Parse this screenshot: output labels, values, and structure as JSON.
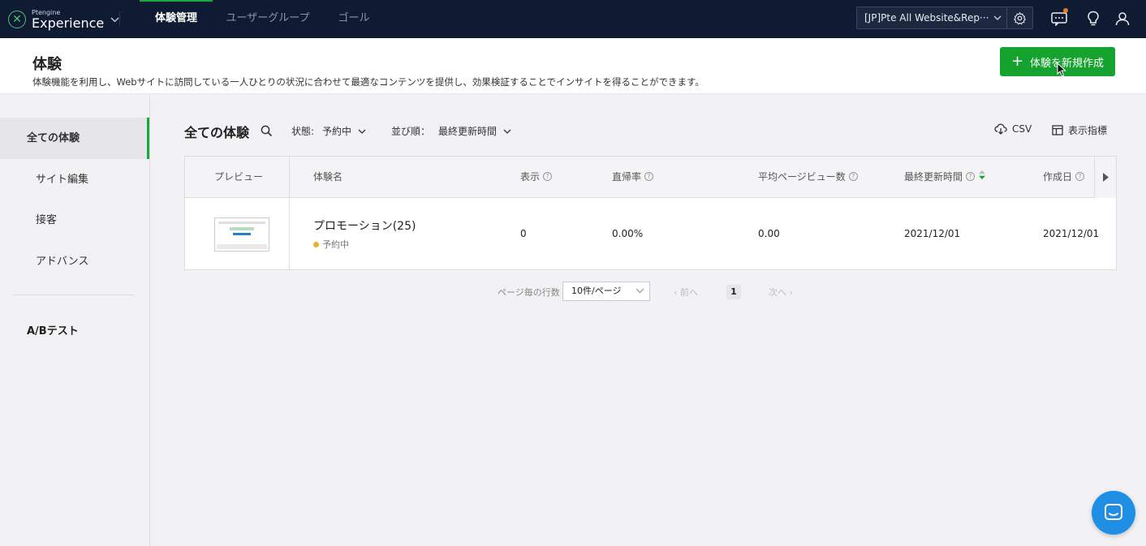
{
  "app": {
    "logo_small": "Ptengine",
    "logo_big": "Experience"
  },
  "nav": {
    "tabs": [
      {
        "label": "体験管理",
        "active": true
      },
      {
        "label": "ユーザーグループ",
        "active": false
      },
      {
        "label": "ゴール",
        "active": false
      }
    ],
    "site_selector": "[JP]Pte All Website&Rep···"
  },
  "header": {
    "title": "体験",
    "description": "体験機能を利用し、Webサイトに訪問している一人ひとりの状況に合わせて最適なコンテンツを提供し、効果検証することでインサイトを得ることができます。",
    "create_button": "体験を新規作成"
  },
  "sidebar": {
    "items": [
      {
        "label": "全ての体験",
        "active": true
      },
      {
        "label": "サイト編集",
        "active": false
      },
      {
        "label": "接客",
        "active": false
      },
      {
        "label": "アドバンス",
        "active": false
      }
    ],
    "section": "A/Bテスト"
  },
  "list": {
    "title": "全ての体験",
    "status_label": "状態:",
    "status_value": "予約中",
    "sort_label": "並び順：",
    "sort_value": "最終更新時間",
    "csv_label": "CSV",
    "metrics_label": "表示指標"
  },
  "table": {
    "headers": {
      "preview": "プレビュー",
      "name": "体験名",
      "views": "表示",
      "bounce": "直帰率",
      "avg_pv": "平均ページビュー数",
      "updated": "最終更新時間",
      "created": "作成日"
    },
    "rows": [
      {
        "name": "プロモーション(25)",
        "status": "予約中",
        "views": "0",
        "bounce": "0.00%",
        "avg_pv": "0.00",
        "updated": "2021/12/01",
        "created": "2021/12/01"
      }
    ]
  },
  "pagination": {
    "rows_label": "ページ毎の行数",
    "per_page": "10件/ページ",
    "prev": "前へ",
    "current": "1",
    "next": "次へ"
  },
  "colors": {
    "accent": "#16a22f",
    "nav_bg": "#0f1b33",
    "status_scheduled": "#e8b22b",
    "chat": "#1f8fe6"
  }
}
